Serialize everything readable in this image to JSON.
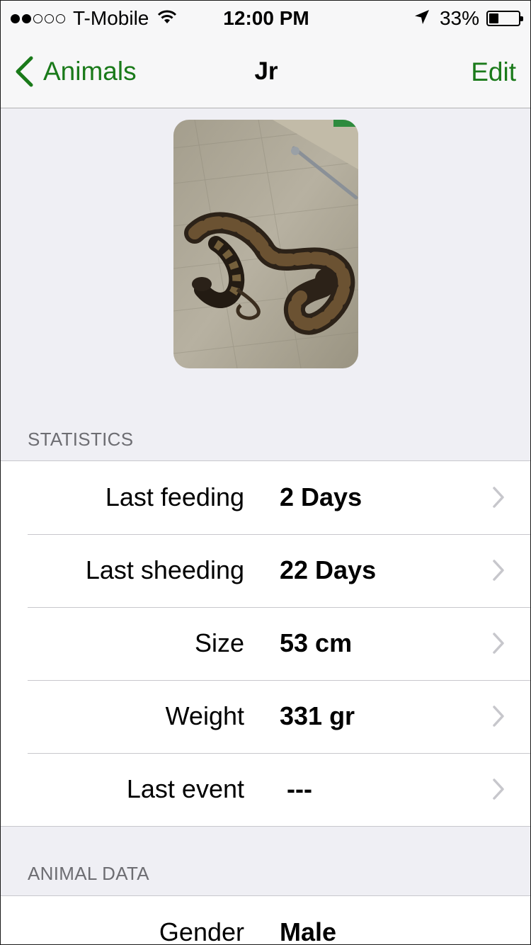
{
  "status_bar": {
    "carrier": "T-Mobile",
    "time": "12:00 PM",
    "battery_percent": "33%",
    "battery_level": 0.33,
    "signal_bars_filled": 2,
    "signal_bars_total": 5,
    "icons": [
      "signal-dots-icon",
      "wifi-icon",
      "location-arrow-icon",
      "battery-icon"
    ]
  },
  "nav": {
    "back_label": "Animals",
    "title": "Jr",
    "edit_label": "Edit",
    "accent_color": "#1a7a1a"
  },
  "photo": {
    "alt": "snake photo"
  },
  "statistics": {
    "header": "STATISTICS",
    "rows": [
      {
        "label": "Last feeding",
        "value": "2 Days"
      },
      {
        "label": "Last sheeding",
        "value": "22 Days"
      },
      {
        "label": "Size",
        "value": "53 cm"
      },
      {
        "label": "Weight",
        "value": "331 gr"
      },
      {
        "label": "Last event",
        "value": " ---"
      }
    ]
  },
  "animal_data": {
    "header": "ANIMAL DATA",
    "rows": [
      {
        "label": "Gender",
        "value": "Male"
      }
    ]
  }
}
